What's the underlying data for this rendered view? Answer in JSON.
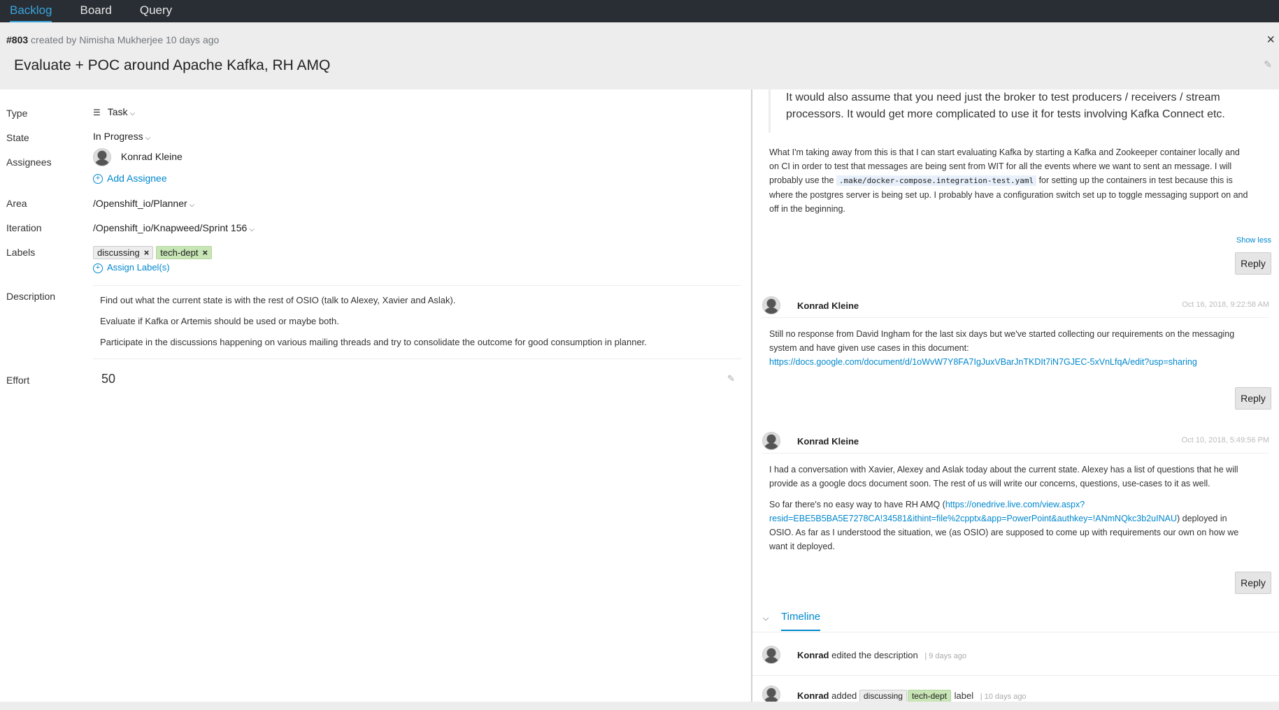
{
  "nav": {
    "tabs": [
      "Backlog",
      "Board",
      "Query"
    ]
  },
  "header": {
    "number": "#803",
    "created_text": "created by Nimisha Mukherjee 10 days ago",
    "title": "Evaluate + POC around Apache Kafka, RH AMQ",
    "close_glyph": "×"
  },
  "fields": {
    "type_label": "Type",
    "type_value": "Task",
    "state_label": "State",
    "state_value": "In Progress",
    "assignees_label": "Assignees",
    "assignee_name": "Konrad Kleine",
    "add_assignee": "Add Assignee",
    "area_label": "Area",
    "area_value": "/Openshift_io/Planner",
    "iteration_label": "Iteration",
    "iteration_value": "/Openshift_io/Knapweed/Sprint 156",
    "labels_label": "Labels",
    "label_1": "discussing",
    "label_2": "tech-dept",
    "assign_labels": "Assign Label(s)",
    "description_label": "Description",
    "description_lines": [
      "Find out what the current state is with the rest of OSIO (talk to Alexey, Xavier and Aslak).",
      "Evaluate if Kafka or Artemis should be used or maybe both.",
      "Participate in the discussions happening on various mailing threads and try to consolidate the outcome for good consumption in planner."
    ],
    "effort_label": "Effort",
    "effort_value": "50"
  },
  "comments": {
    "quote": "It would also assume that you need just the broker to test producers / receivers / stream processors. It would get more complicated to use it for tests involving Kafka Connect etc.",
    "c0_part1": "What I'm taking away from this is that I can start evaluating Kafka by starting a Kafka and Zookeeper container locally and on CI in order to test that messages are being sent from WIT for all the events where we want to sent an message. I will probably use the",
    "c0_code": ".make/docker-compose.integration-test.yaml",
    "c0_part2": "for setting up the containers in test because this is where the postgres server is being set up. I probably have a configuration switch set up to toggle messaging support on and off in the beginning.",
    "show_less": "Show less",
    "reply": "Reply",
    "c1_author": "Konrad Kleine",
    "c1_time": "Oct 16, 2018, 9:22:58 AM",
    "c1_text": "Still no response from David Ingham for the last six days but we've started collecting our requirements on the messaging system and have given use cases in this document:",
    "c1_link": "https://docs.google.com/document/d/1oWvW7Y8FA7IgJuxVBarJnTKDIt7iN7GJEC-5xVnLfqA/edit?usp=sharing",
    "c2_author": "Konrad Kleine",
    "c2_time": "Oct 10, 2018, 5:49:56 PM",
    "c2_text1": "I had a conversation with Xavier, Alexey and Aslak today about the current state. Alexey has a list of questions that he will provide as a google docs document soon. The rest of us will write our concerns, questions, use-cases to it as well.",
    "c2_text2a": "So far there's no easy way to have RH AMQ (",
    "c2_link": "https://onedrive.live.com/view.aspx?resid=EBE5B5BA5E7278CA!34581&ithint=file%2cpptx&app=PowerPoint&authkey=!ANmNQkc3b2uINAU",
    "c2_text2b": ") deployed in OSIO. As far as I understood the situation, we (as OSIO) are supposed to come up with requirements our own on how we want it deployed."
  },
  "timeline": {
    "tab": "Timeline",
    "i1_user": "Konrad",
    "i1_action": "edited the description",
    "i1_ago": "| 9 days ago",
    "i2_user": "Konrad",
    "i2_action": "added",
    "i2_label1": "discussing",
    "i2_label2": "tech-dept",
    "i2_suffix": "label",
    "i2_ago": "| 10 days ago"
  },
  "colors": {
    "accent": "#0088ce",
    "nav_bg": "#292e34",
    "label_green": "#c7e5b5"
  }
}
